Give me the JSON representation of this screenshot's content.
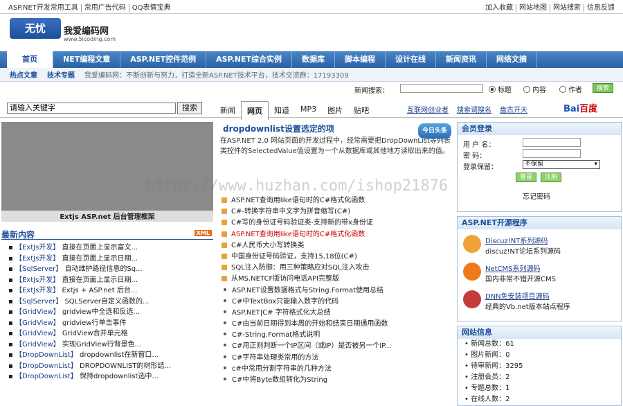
{
  "topbar": {
    "left": [
      "ASP.NET开发常用工具",
      "常用广告代码",
      "QQ表情宝典"
    ],
    "right": [
      "加入收藏",
      "网站地图",
      "网站搜索",
      "信息反馈"
    ]
  },
  "logo": {
    "mark": "无忧",
    "name": "我爱编码网",
    "url": "www.5icoding.com"
  },
  "nav": [
    "首页",
    "NET编程文章",
    "ASP.NET控件范例",
    "ASP.NET综合实例",
    "数据库",
    "脚本编程",
    "设计在线",
    "新闻资讯",
    "网络文摘"
  ],
  "subnav": {
    "hot": "热点文章",
    "topic": "技术专题",
    "slogan": "我爱编码网：不断创新与努力，打造全新ASP.NET技术平台，技术交流群：17193309"
  },
  "site_search": {
    "label": "新闻搜索：",
    "options": [
      "标题",
      "内容",
      "作者"
    ],
    "button": "搜索"
  },
  "search": {
    "keyword": "请输入关键字",
    "button": "搜索",
    "tabs": [
      "新闻",
      "网页",
      "知道",
      "MP3",
      "图片",
      "贴吧"
    ],
    "links": [
      "互联网创业者",
      "搜索调搜名",
      "盘古开天"
    ],
    "baidu_a": "Bai",
    "baidu_b": "百度"
  },
  "banner": {
    "caption": "Extjs  ASP.net 后台管理框架"
  },
  "latest": {
    "title": "最新内容",
    "xml": "XML",
    "items": [
      {
        "cat": "【ExtJs开发】",
        "text": "直接在页面上显示富文..."
      },
      {
        "cat": "【ExtJs开发】",
        "text": "直接在页面上显示日期..."
      },
      {
        "cat": "【SqlServer】",
        "text": "自动维护路径信息的Sq..."
      },
      {
        "cat": "【ExtJs开发】",
        "text": "直接在页面上显示日期..."
      },
      {
        "cat": "【ExtJs开发】",
        "text": "Extjs + ASP.net 后台..."
      },
      {
        "cat": "【SqlServer】",
        "text": "SQLServer自定义函数的..."
      },
      {
        "cat": "【GridView】",
        "text": "gridview中全选和反选..."
      },
      {
        "cat": "【GridView】",
        "text": "gridview行单击事件"
      },
      {
        "cat": "【GridView】",
        "text": "GridView合并单元格"
      },
      {
        "cat": "【GridView】",
        "text": "实现GridView行背景色..."
      },
      {
        "cat": "【DropDownList】",
        "text": "dropdownlist在新窗口..."
      },
      {
        "cat": "【DropDownList】",
        "text": "DROPDOWNLIST的树形结..."
      },
      {
        "cat": "【DropDownList】",
        "text": "保持dropdownlist选中..."
      }
    ]
  },
  "featured": {
    "title": "dropdownlist设置选定的项",
    "badge": "今日头条",
    "desc": "在ASP.NET 2.0 网站页面的开发过程中，经常需要把DropDownList等列表类控件的SelectedValue值设置为一个从数据库或其他地方读取出来的值。"
  },
  "articles": [
    {
      "text": "ASP.NET查询用like语句时的C#格式化函数",
      "red": false,
      "icon": true
    },
    {
      "text": "C#-转换字符串中文字为拼音缩写(C#)",
      "red": false,
      "icon": true
    },
    {
      "text": "C#写的身份证号码验证类-支持新的带x身份证",
      "red": false,
      "icon": true
    },
    {
      "text": "ASP.NET查询用like语句时的C#格式化函数",
      "red": true,
      "icon": true
    },
    {
      "text": "C#人民币大小写转换类",
      "red": false,
      "icon": true
    },
    {
      "text": "中国身份证号码验证，支持15,18位(C#)",
      "red": false,
      "icon": true
    },
    {
      "text": "SQL注入防御：用三种策略应对SQL注入攻击",
      "red": false,
      "icon": true
    },
    {
      "text": "从MS.NETCF版访问电话API完整版",
      "red": false,
      "icon": true
    },
    {
      "text": "ASP.NET设置数据格式与String.Format使用总结",
      "red": false,
      "icon": false
    },
    {
      "text": "C#中TextBox只能输入数字的代码",
      "red": false,
      "icon": false
    },
    {
      "text": "ASP.NET|C# 字符格式化大总结",
      "red": false,
      "icon": false
    },
    {
      "text": "C#由当前日期得到本周的开始和结束日期通用函数",
      "red": false,
      "icon": false
    },
    {
      "text": "C#-String.Format格式说明",
      "red": false,
      "icon": false
    },
    {
      "text": "C#用正则判断一个IP区间（或IP）是否被另一个IP...",
      "red": false,
      "icon": false
    },
    {
      "text": "C#字符串处理类常用的方法",
      "red": false,
      "icon": false
    },
    {
      "text": "c#中常用分割字符串的几种方法",
      "red": false,
      "icon": false
    },
    {
      "text": "C#中将Byte数组转化为String",
      "red": false,
      "icon": false
    }
  ],
  "login": {
    "title": "会员登录",
    "user": "用 户 名：",
    "pass": "密    码：",
    "keep": "登录保留：",
    "keep_value": "不保留",
    "login_btn": "登录",
    "reg_btn": "注册",
    "forgot": "忘记密码"
  },
  "opensource": {
    "title": "ASP.NET开源程序",
    "items": [
      {
        "name": "Discuz!NT系列源码",
        "desc": "discuz!NT论坛系列源码"
      },
      {
        "name": "NetCMS系列源码",
        "desc": "国内非常不错开源CMS"
      },
      {
        "name": "DNN免安装项目源码",
        "desc": "经典的Vb.net版本站点程序"
      }
    ]
  },
  "stats": {
    "title": "网站信息",
    "rows": [
      "新闻总数：61",
      "图片新闻：0",
      "待审新闻：3295",
      "注册会员：2",
      "专题总数：1",
      "在线人数：2"
    ]
  },
  "watermark": "https://www.huzhan.com/ishop21876",
  "colors": {
    "brand": "#1d4f9b",
    "nav": "#2a62a6",
    "accent_red": "#cc0000"
  }
}
